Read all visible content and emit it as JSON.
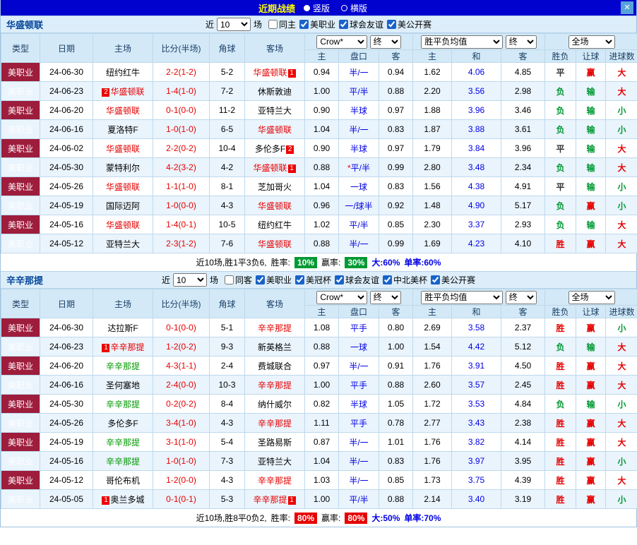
{
  "topbar": {
    "title": "近期战绩",
    "radio_selected": "竖版",
    "radio_unselected": "横版",
    "close_glyph": "✕"
  },
  "colors": {
    "titlebar_blue": "#0202cf",
    "title_yellow": "#ffff00",
    "league_cell_maroon": "#9e1d3c",
    "win_red": "#e60000",
    "lose_green": "#009933",
    "odds_blue": "#0000e6",
    "focal_team_red": "#e60000",
    "focal_team_green": "#009900"
  },
  "table_header": {
    "cols": [
      "类型",
      "日期",
      "主场",
      "比分(半场)",
      "角球",
      "客场"
    ],
    "sub_cols": [
      "主",
      "盘口",
      "客",
      "主",
      "和",
      "客",
      "胜负",
      "让球",
      "进球数"
    ],
    "odds_select": "Crow*",
    "odds_state": "终",
    "avg_select": "胜平负均值",
    "avg_state": "终",
    "scope_select": "全场"
  },
  "sections": [
    {
      "team": "华盛顿联",
      "filter": {
        "near": "近",
        "count": "10",
        "games": "场",
        "checkboxes": [
          {
            "label": "同主",
            "checked": false
          },
          {
            "label": "美职业",
            "checked": true
          },
          {
            "label": "球会友谊",
            "checked": true
          },
          {
            "label": "美公开赛",
            "checked": true
          }
        ]
      },
      "rows": [
        {
          "league": "美职业",
          "date": "24-06-30",
          "home": {
            "n": "纽约红牛",
            "c": "#000000"
          },
          "score": "2-2(1-2)",
          "corners": "5-2",
          "away": {
            "n": "华盛顿联",
            "c": "#e60000",
            "b2": "1"
          },
          "ah_home": "0.94",
          "ah_line": "半/一",
          "ah_away": "0.94",
          "odds_home": "1.62",
          "odds_draw": "4.06",
          "odds_away": "4.85",
          "result": "平",
          "handicap_result": "赢",
          "goals": "大"
        },
        {
          "league": "美职业",
          "date": "24-06-23",
          "home": {
            "n": "华盛顿联",
            "c": "#e60000",
            "b1": "2"
          },
          "score": "1-4(1-0)",
          "corners": "7-2",
          "away": {
            "n": "休斯敦迪",
            "c": "#000000"
          },
          "ah_home": "1.00",
          "ah_line": "平/半",
          "ah_away": "0.88",
          "odds_home": "2.20",
          "odds_draw": "3.56",
          "odds_away": "2.98",
          "result": "负",
          "handicap_result": "输",
          "goals": "大"
        },
        {
          "league": "美职业",
          "date": "24-06-20",
          "home": {
            "n": "华盛顿联",
            "c": "#e60000"
          },
          "score": "0-1(0-0)",
          "corners": "11-2",
          "away": {
            "n": "亚特兰大",
            "c": "#000000"
          },
          "ah_home": "0.90",
          "ah_line": "半球",
          "ah_away": "0.97",
          "odds_home": "1.88",
          "odds_draw": "3.96",
          "odds_away": "3.46",
          "result": "负",
          "handicap_result": "输",
          "goals": "小"
        },
        {
          "league": "美职业",
          "date": "24-06-16",
          "home": {
            "n": "夏洛特F",
            "c": "#000000"
          },
          "score": "1-0(1-0)",
          "corners": "6-5",
          "away": {
            "n": "华盛顿联",
            "c": "#e60000"
          },
          "ah_home": "1.04",
          "ah_line": "半/一",
          "ah_away": "0.83",
          "odds_home": "1.87",
          "odds_draw": "3.88",
          "odds_away": "3.61",
          "result": "负",
          "handicap_result": "输",
          "goals": "小"
        },
        {
          "league": "美职业",
          "date": "24-06-02",
          "home": {
            "n": "华盛顿联",
            "c": "#e60000"
          },
          "score": "2-2(0-2)",
          "corners": "10-4",
          "away": {
            "n": "多伦多F",
            "c": "#000000",
            "b2": "2"
          },
          "ah_home": "0.90",
          "ah_line": "半球",
          "ah_away": "0.97",
          "odds_home": "1.79",
          "odds_draw": "3.84",
          "odds_away": "3.96",
          "result": "平",
          "handicap_result": "输",
          "goals": "大"
        },
        {
          "league": "美职业",
          "date": "24-05-30",
          "home": {
            "n": "蒙特利尔",
            "c": "#000000"
          },
          "score": "4-2(3-2)",
          "corners": "4-2",
          "away": {
            "n": "华盛顿联",
            "c": "#e60000",
            "b2": "1"
          },
          "ah_home": "0.88",
          "ah_line": "*平/半",
          "ah_away": "0.99",
          "odds_home": "2.80",
          "odds_draw": "3.48",
          "odds_away": "2.34",
          "result": "负",
          "handicap_result": "输",
          "goals": "大"
        },
        {
          "league": "美职业",
          "date": "24-05-26",
          "home": {
            "n": "华盛顿联",
            "c": "#e60000"
          },
          "score": "1-1(1-0)",
          "corners": "8-1",
          "away": {
            "n": "芝加哥火",
            "c": "#000000"
          },
          "ah_home": "1.04",
          "ah_line": "一球",
          "ah_away": "0.83",
          "odds_home": "1.56",
          "odds_draw": "4.38",
          "odds_away": "4.91",
          "result": "平",
          "handicap_result": "输",
          "goals": "小"
        },
        {
          "league": "美职业",
          "date": "24-05-19",
          "home": {
            "n": "国际迈阿",
            "c": "#000000"
          },
          "score": "1-0(0-0)",
          "corners": "4-3",
          "away": {
            "n": "华盛顿联",
            "c": "#e60000"
          },
          "ah_home": "0.96",
          "ah_line": "一/球半",
          "ah_away": "0.92",
          "odds_home": "1.48",
          "odds_draw": "4.90",
          "odds_away": "5.17",
          "result": "负",
          "handicap_result": "赢",
          "goals": "小"
        },
        {
          "league": "美职业",
          "date": "24-05-16",
          "home": {
            "n": "华盛顿联",
            "c": "#e60000"
          },
          "score": "1-4(0-1)",
          "corners": "10-5",
          "away": {
            "n": "纽约红牛",
            "c": "#000000"
          },
          "ah_home": "1.02",
          "ah_line": "平/半",
          "ah_away": "0.85",
          "odds_home": "2.30",
          "odds_draw": "3.37",
          "odds_away": "2.93",
          "result": "负",
          "handicap_result": "输",
          "goals": "大"
        },
        {
          "league": "美职业",
          "date": "24-05-12",
          "home": {
            "n": "亚特兰大",
            "c": "#000000"
          },
          "score": "2-3(1-2)",
          "corners": "7-6",
          "away": {
            "n": "华盛顿联",
            "c": "#e60000"
          },
          "ah_home": "0.88",
          "ah_line": "半/一",
          "ah_away": "0.99",
          "odds_home": "1.69",
          "odds_draw": "4.23",
          "odds_away": "4.10",
          "result": "胜",
          "handicap_result": "赢",
          "goals": "大"
        }
      ],
      "footer": {
        "summary": "近10场,胜1平3负6,",
        "win_rate_label": "胜率:",
        "win_rate": "10%",
        "win_rate_color": "#009933",
        "handicap_rate_label": "赢率:",
        "handicap_rate": "30%",
        "handicap_rate_color": "#009933",
        "big_rate": "大:60%",
        "odd_rate": "单率:60%"
      }
    },
    {
      "team": "辛辛那提",
      "filter": {
        "near": "近",
        "count": "10",
        "games": "场",
        "checkboxes": [
          {
            "label": "同客",
            "checked": false
          },
          {
            "label": "美职业",
            "checked": true
          },
          {
            "label": "美冠杯",
            "checked": true
          },
          {
            "label": "球会友谊",
            "checked": true
          },
          {
            "label": "中北美杯",
            "checked": true
          },
          {
            "label": "美公开赛",
            "checked": true
          }
        ]
      },
      "rows": [
        {
          "league": "美职业",
          "date": "24-06-30",
          "home": {
            "n": "达拉斯F",
            "c": "#000000"
          },
          "score": "0-1(0-0)",
          "corners": "5-1",
          "away": {
            "n": "辛辛那提",
            "c": "#e60000"
          },
          "ah_home": "1.08",
          "ah_line": "平手",
          "ah_away": "0.80",
          "odds_home": "2.69",
          "odds_draw": "3.58",
          "odds_away": "2.37",
          "result": "胜",
          "handicap_result": "赢",
          "goals": "小"
        },
        {
          "league": "美职业",
          "date": "24-06-23",
          "home": {
            "n": "辛辛那提",
            "c": "#e60000",
            "b1": "1"
          },
          "score": "1-2(0-2)",
          "corners": "9-3",
          "away": {
            "n": "新英格兰",
            "c": "#000000"
          },
          "ah_home": "0.88",
          "ah_line": "一球",
          "ah_away": "1.00",
          "odds_home": "1.54",
          "odds_draw": "4.42",
          "odds_away": "5.12",
          "result": "负",
          "handicap_result": "输",
          "goals": "大"
        },
        {
          "league": "美职业",
          "date": "24-06-20",
          "home": {
            "n": "辛辛那提",
            "c": "#009900"
          },
          "score": "4-3(1-1)",
          "corners": "2-4",
          "away": {
            "n": "费城联合",
            "c": "#000000"
          },
          "ah_home": "0.97",
          "ah_line": "半/一",
          "ah_away": "0.91",
          "odds_home": "1.76",
          "odds_draw": "3.91",
          "odds_away": "4.50",
          "result": "胜",
          "handicap_result": "赢",
          "goals": "大"
        },
        {
          "league": "美职业",
          "date": "24-06-16",
          "home": {
            "n": "圣何塞地",
            "c": "#000000"
          },
          "score": "2-4(0-0)",
          "corners": "10-3",
          "away": {
            "n": "辛辛那提",
            "c": "#e60000"
          },
          "ah_home": "1.00",
          "ah_line": "平手",
          "ah_away": "0.88",
          "odds_home": "2.60",
          "odds_draw": "3.57",
          "odds_away": "2.45",
          "result": "胜",
          "handicap_result": "赢",
          "goals": "大"
        },
        {
          "league": "美职业",
          "date": "24-05-30",
          "home": {
            "n": "辛辛那提",
            "c": "#009900"
          },
          "score": "0-2(0-2)",
          "corners": "8-4",
          "away": {
            "n": "纳什威尔",
            "c": "#000000"
          },
          "ah_home": "0.82",
          "ah_line": "半球",
          "ah_away": "1.05",
          "odds_home": "1.72",
          "odds_draw": "3.53",
          "odds_away": "4.84",
          "result": "负",
          "handicap_result": "输",
          "goals": "小"
        },
        {
          "league": "美职业",
          "date": "24-05-26",
          "home": {
            "n": "多伦多F",
            "c": "#000000"
          },
          "score": "3-4(1-0)",
          "corners": "4-3",
          "away": {
            "n": "辛辛那提",
            "c": "#e60000"
          },
          "ah_home": "1.11",
          "ah_line": "平手",
          "ah_away": "0.78",
          "odds_home": "2.77",
          "odds_draw": "3.43",
          "odds_away": "2.38",
          "result": "胜",
          "handicap_result": "赢",
          "goals": "大"
        },
        {
          "league": "美职业",
          "date": "24-05-19",
          "home": {
            "n": "辛辛那提",
            "c": "#009900"
          },
          "score": "3-1(1-0)",
          "corners": "5-4",
          "away": {
            "n": "圣路易斯",
            "c": "#000000"
          },
          "ah_home": "0.87",
          "ah_line": "半/一",
          "ah_away": "1.01",
          "odds_home": "1.76",
          "odds_draw": "3.82",
          "odds_away": "4.14",
          "result": "胜",
          "handicap_result": "赢",
          "goals": "大"
        },
        {
          "league": "美职业",
          "date": "24-05-16",
          "home": {
            "n": "辛辛那提",
            "c": "#009900"
          },
          "score": "1-0(1-0)",
          "corners": "7-3",
          "away": {
            "n": "亚特兰大",
            "c": "#000000"
          },
          "ah_home": "1.04",
          "ah_line": "半/一",
          "ah_away": "0.83",
          "odds_home": "1.76",
          "odds_draw": "3.97",
          "odds_away": "3.95",
          "result": "胜",
          "handicap_result": "赢",
          "goals": "小"
        },
        {
          "league": "美职业",
          "date": "24-05-12",
          "home": {
            "n": "哥伦布机",
            "c": "#000000"
          },
          "score": "1-2(0-0)",
          "corners": "4-3",
          "away": {
            "n": "辛辛那提",
            "c": "#e60000"
          },
          "ah_home": "1.03",
          "ah_line": "半/一",
          "ah_away": "0.85",
          "odds_home": "1.73",
          "odds_draw": "3.75",
          "odds_away": "4.39",
          "result": "胜",
          "handicap_result": "赢",
          "goals": "大"
        },
        {
          "league": "美职业",
          "date": "24-05-05",
          "home": {
            "n": "奥兰多城",
            "c": "#000000",
            "b1": "1"
          },
          "score": "0-1(0-1)",
          "corners": "5-3",
          "away": {
            "n": "辛辛那提",
            "c": "#e60000",
            "b2": "1"
          },
          "ah_home": "1.00",
          "ah_line": "平/半",
          "ah_away": "0.88",
          "odds_home": "2.14",
          "odds_draw": "3.40",
          "odds_away": "3.19",
          "result": "胜",
          "handicap_result": "赢",
          "goals": "小"
        }
      ],
      "footer": {
        "summary": "近10场,胜8平0负2,",
        "win_rate_label": "胜率:",
        "win_rate": "80%",
        "win_rate_color": "#e60000",
        "handicap_rate_label": "赢率:",
        "handicap_rate": "80%",
        "handicap_rate_color": "#e60000",
        "big_rate": "大:50%",
        "odd_rate": "单率:70%"
      }
    }
  ]
}
